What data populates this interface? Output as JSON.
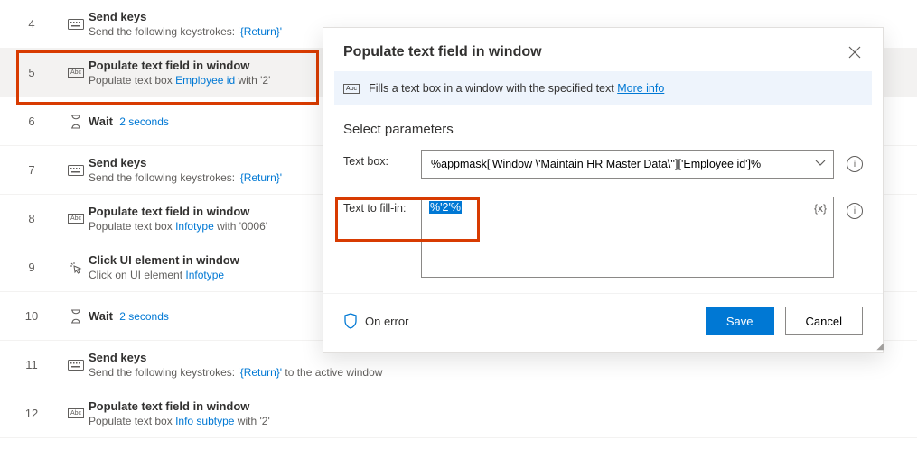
{
  "steps": [
    {
      "num": "4",
      "icon": "keyboard",
      "title": "Send keys",
      "desc_pre": "Send the following keystrokes: ",
      "desc_link": "'{Return}'",
      "desc_post": ""
    },
    {
      "num": "5",
      "icon": "abc",
      "title": "Populate text field in window",
      "desc_pre": "Populate text box ",
      "desc_link": "Employee id",
      "desc_post": " with '2'",
      "selected": true
    },
    {
      "num": "6",
      "icon": "hourglass",
      "title": "Wait",
      "inline": "2 seconds"
    },
    {
      "num": "7",
      "icon": "keyboard",
      "title": "Send keys",
      "desc_pre": "Send the following keystrokes: ",
      "desc_link": "'{Return}'",
      "desc_post": ""
    },
    {
      "num": "8",
      "icon": "abc",
      "title": "Populate text field in window",
      "desc_pre": "Populate text box ",
      "desc_link": "Infotype",
      "desc_post": " with '0006'"
    },
    {
      "num": "9",
      "icon": "click",
      "title": "Click UI element in window",
      "desc_pre": "Click on UI element ",
      "desc_link": "Infotype",
      "desc_post": ""
    },
    {
      "num": "10",
      "icon": "hourglass",
      "title": "Wait",
      "inline": "2 seconds"
    },
    {
      "num": "11",
      "icon": "keyboard",
      "title": "Send keys",
      "desc_pre": "Send the following keystrokes: ",
      "desc_link": "'{Return}'",
      "desc_post": " to the active window"
    },
    {
      "num": "12",
      "icon": "abc",
      "title": "Populate text field in window",
      "desc_pre": "Populate text box ",
      "desc_link": "Info subtype",
      "desc_post": " with '2'"
    }
  ],
  "panel": {
    "title": "Populate text field in window",
    "banner_text": "Fills a text box in a window with the specified text ",
    "banner_link": "More info",
    "section": "Select parameters",
    "param_textbox_label": "Text box:",
    "param_textbox_value": "%appmask['Window \\'Maintain HR Master Data\\'']['Employee id']%",
    "param_fill_label": "Text to fill-in:",
    "param_fill_value": "%'2'%",
    "fx_label": "{x}",
    "on_error": "On error",
    "save": "Save",
    "cancel": "Cancel"
  }
}
